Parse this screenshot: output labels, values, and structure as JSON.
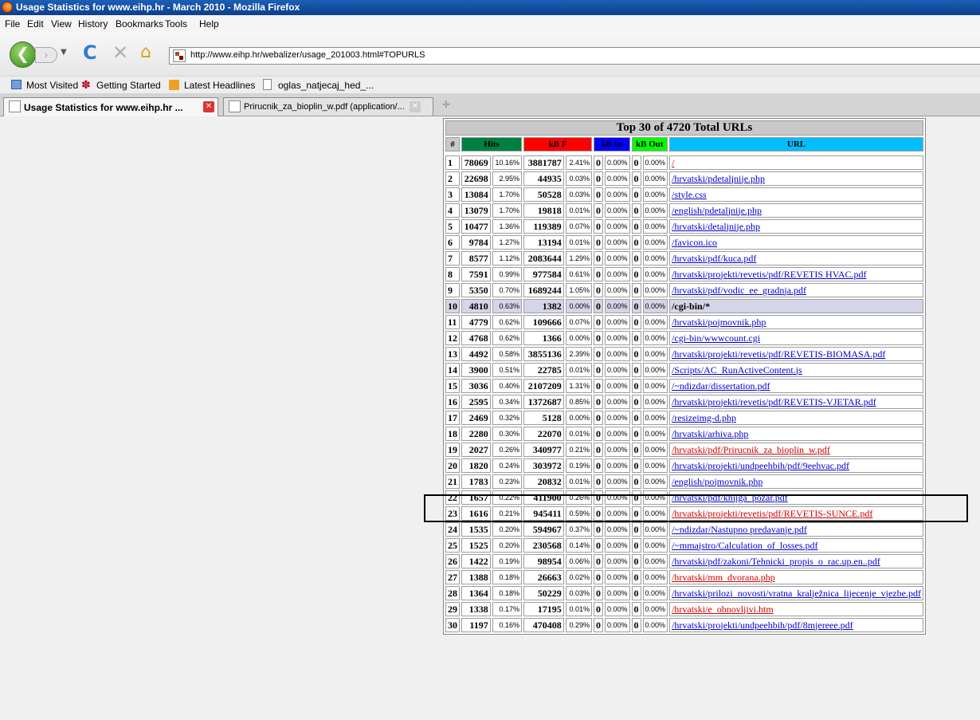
{
  "window": {
    "title": "Usage Statistics for www.eihp.hr - March 2010 - Mozilla Firefox"
  },
  "menu": [
    "File",
    "Edit",
    "View",
    "History",
    "Bookmarks",
    "Tools",
    "Help"
  ],
  "address": {
    "url": "http://www.eihp.hr/webalizer/usage_201003.html#TOPURLS"
  },
  "bookmarks": [
    "Most Visited",
    "Getting Started",
    "Latest Headlines",
    "oglas_natjecaj_hed_..."
  ],
  "tabs": [
    {
      "label": "Usage Statistics for www.eihp.hr ..."
    },
    {
      "label": "Prirucnik_za_bioplin_w.pdf (application/..."
    }
  ],
  "table": {
    "caption": "Top 30 of 4720 Total URLs",
    "headers": {
      "rank": "#",
      "hits": "Hits",
      "kbf": "kB F",
      "kbin": "kB In",
      "kbout": "kB Out",
      "url": "URL"
    },
    "header_colors": {
      "hits": "#008040",
      "kbf": "#ff0000",
      "kbin": "#0000ff",
      "kbout": "#00ff00",
      "url": "#00bfff"
    },
    "rows": [
      [
        "1",
        "78069",
        "10.16%",
        "3881787",
        "2.41%",
        "0",
        "0.00%",
        "0",
        "0.00%",
        "/"
      ],
      [
        "2",
        "22698",
        "2.95%",
        "44935",
        "0.03%",
        "0",
        "0.00%",
        "0",
        "0.00%",
        "/hrvatski/pdetaljnije.php"
      ],
      [
        "3",
        "13084",
        "1.70%",
        "50528",
        "0.03%",
        "0",
        "0.00%",
        "0",
        "0.00%",
        "/style.css"
      ],
      [
        "4",
        "13079",
        "1.70%",
        "19818",
        "0.01%",
        "0",
        "0.00%",
        "0",
        "0.00%",
        "/english/pdetaljnije.php"
      ],
      [
        "5",
        "10477",
        "1.36%",
        "119389",
        "0.07%",
        "0",
        "0.00%",
        "0",
        "0.00%",
        "/hrvatski/detaljnije.php"
      ],
      [
        "6",
        "9784",
        "1.27%",
        "13194",
        "0.01%",
        "0",
        "0.00%",
        "0",
        "0.00%",
        "/favicon.ico"
      ],
      [
        "7",
        "8577",
        "1.12%",
        "2083644",
        "1.29%",
        "0",
        "0.00%",
        "0",
        "0.00%",
        "/hrvatski/pdf/kuca.pdf"
      ],
      [
        "8",
        "7591",
        "0.99%",
        "977584",
        "0.61%",
        "0",
        "0.00%",
        "0",
        "0.00%",
        "/hrvatski/projekti/revetis/pdf/REVETIS HVAC.pdf"
      ],
      [
        "9",
        "5350",
        "0.70%",
        "1689244",
        "1.05%",
        "0",
        "0.00%",
        "0",
        "0.00%",
        "/hrvatski/pdf/vodic_ee_gradnja.pdf"
      ],
      [
        "10",
        "4810",
        "0.63%",
        "1382",
        "0.00%",
        "0",
        "0.00%",
        "0",
        "0.00%",
        "/cgi-bin/*"
      ],
      [
        "11",
        "4779",
        "0.62%",
        "109666",
        "0.07%",
        "0",
        "0.00%",
        "0",
        "0.00%",
        "/hrvatski/pojmovnik.php"
      ],
      [
        "12",
        "4768",
        "0.62%",
        "1366",
        "0.00%",
        "0",
        "0.00%",
        "0",
        "0.00%",
        "/cgi-bin/wwwcount.cgi"
      ],
      [
        "13",
        "4492",
        "0.58%",
        "3855136",
        "2.39%",
        "0",
        "0.00%",
        "0",
        "0.00%",
        "/hrvatski/projekti/revetis/pdf/REVETIS-BIOMASA.pdf"
      ],
      [
        "14",
        "3900",
        "0.51%",
        "22785",
        "0.01%",
        "0",
        "0.00%",
        "0",
        "0.00%",
        "/Scripts/AC_RunActiveContent.js"
      ],
      [
        "15",
        "3036",
        "0.40%",
        "2107209",
        "1.31%",
        "0",
        "0.00%",
        "0",
        "0.00%",
        "/~ndizdar/dissertation.pdf"
      ],
      [
        "16",
        "2595",
        "0.34%",
        "1372687",
        "0.85%",
        "0",
        "0.00%",
        "0",
        "0.00%",
        "/hrvatski/projekti/revetis/pdf/REVETIS-VJETAR.pdf"
      ],
      [
        "17",
        "2469",
        "0.32%",
        "5128",
        "0.00%",
        "0",
        "0.00%",
        "0",
        "0.00%",
        "/resizeimg-d.php"
      ],
      [
        "18",
        "2280",
        "0.30%",
        "22070",
        "0.01%",
        "0",
        "0.00%",
        "0",
        "0.00%",
        "/hrvatski/arhiva.php"
      ],
      [
        "19",
        "2027",
        "0.26%",
        "340977",
        "0.21%",
        "0",
        "0.00%",
        "0",
        "0.00%",
        "/hrvatski/pdf/Prirucnik_za_bioplin_w.pdf"
      ],
      [
        "20",
        "1820",
        "0.24%",
        "303972",
        "0.19%",
        "0",
        "0.00%",
        "0",
        "0.00%",
        "/hrvatski/projekti/undpeehbih/pdf/9eehvac.pdf"
      ],
      [
        "21",
        "1783",
        "0.23%",
        "20832",
        "0.01%",
        "0",
        "0.00%",
        "0",
        "0.00%",
        "/english/pojmovnik.php"
      ],
      [
        "22",
        "1657",
        "0.22%",
        "411900",
        "0.26%",
        "0",
        "0.00%",
        "0",
        "0.00%",
        "/hrvatski/pdf/knjiga_pozar.pdf"
      ],
      [
        "23",
        "1616",
        "0.21%",
        "945411",
        "0.59%",
        "0",
        "0.00%",
        "0",
        "0.00%",
        "/hrvatski/projekti/revetis/pdf/REVETIS-SUNCE.pdf"
      ],
      [
        "24",
        "1535",
        "0.20%",
        "594967",
        "0.37%",
        "0",
        "0.00%",
        "0",
        "0.00%",
        "/~ndizdar/Nastupno predavanje.pdf"
      ],
      [
        "25",
        "1525",
        "0.20%",
        "230568",
        "0.14%",
        "0",
        "0.00%",
        "0",
        "0.00%",
        "/~mmajstro/Calculation_of_losses.pdf"
      ],
      [
        "26",
        "1422",
        "0.19%",
        "98954",
        "0.06%",
        "0",
        "0.00%",
        "0",
        "0.00%",
        "/hrvatski/pdf/zakoni/Tehnicki_propis_o_rac.up.en..pdf"
      ],
      [
        "27",
        "1388",
        "0.18%",
        "26663",
        "0.02%",
        "0",
        "0.00%",
        "0",
        "0.00%",
        "/hrvatski/mm_dvorana.php"
      ],
      [
        "28",
        "1364",
        "0.18%",
        "50229",
        "0.03%",
        "0",
        "0.00%",
        "0",
        "0.00%",
        "/hrvatski/prilozi_novosti/vratna_kralježnica_lijecenje_vjezbe.pdf"
      ],
      [
        "29",
        "1338",
        "0.17%",
        "17195",
        "0.01%",
        "0",
        "0.00%",
        "0",
        "0.00%",
        "/hrvatski/e_obnovljivi.htm"
      ],
      [
        "30",
        "1197",
        "0.16%",
        "470408",
        "0.29%",
        "0",
        "0.00%",
        "0",
        "0.00%",
        "/hrvatski/projekti/undpeehbih/pdf/8mjereee.pdf"
      ]
    ],
    "visited_ranks": [
      "1",
      "19",
      "23",
      "27",
      "29"
    ],
    "plain_ranks": [
      "10"
    ],
    "highlighted_rank": "19"
  }
}
